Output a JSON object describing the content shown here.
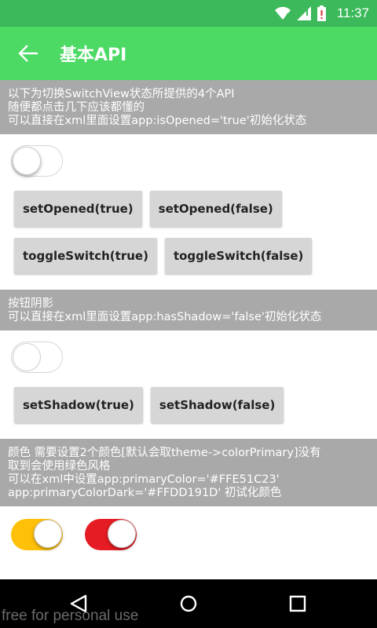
{
  "status_bar": {
    "time": "11:37",
    "icons": [
      "wifi-icon",
      "signal-icon",
      "battery-icon"
    ]
  },
  "toolbar": {
    "title": "基本API",
    "back_icon": "arrow-left-icon"
  },
  "sections": [
    {
      "lines": [
        "以下为切换SwitchView状态所提供的4个API",
        "随便都点击几下应该都懂的",
        "可以直接在xml里面设置app:isOpened='true'初始化状态"
      ],
      "switch_opened": false,
      "buttons": [
        [
          "setOpened(true)",
          "setOpened(false)"
        ],
        [
          "toggleSwitch(true)",
          "toggleSwitch(false)"
        ]
      ]
    },
    {
      "lines": [
        "按钮阴影",
        "可以直接在xml里面设置app:hasShadow='false'初始化状态"
      ],
      "switch_opened": false,
      "buttons": [
        [
          "setShadow(true)",
          "setShadow(false)"
        ]
      ]
    },
    {
      "lines": [
        "颜色 需要设置2个颜色[默认会取theme->colorPrimary]没有",
        "取到会使用绿色风格",
        "可以在xml中设置app:primaryColor='#FFE51C23'",
        "app:primaryColorDark='#FFDD191D' 初试化颜色"
      ],
      "color_switches": [
        {
          "color": "#ffc107",
          "opened": true
        },
        {
          "color": "#e51c23",
          "opened": true
        }
      ]
    }
  ],
  "nav_bar": {
    "icons": [
      "back-triangle-icon",
      "home-circle-icon",
      "recents-square-icon"
    ]
  },
  "watermark": "free for personal use",
  "colors": {
    "status_bar": "#3cb95a",
    "toolbar": "#4cd964",
    "section_header": "#a9a9a9",
    "button": "#d6d6d6"
  }
}
